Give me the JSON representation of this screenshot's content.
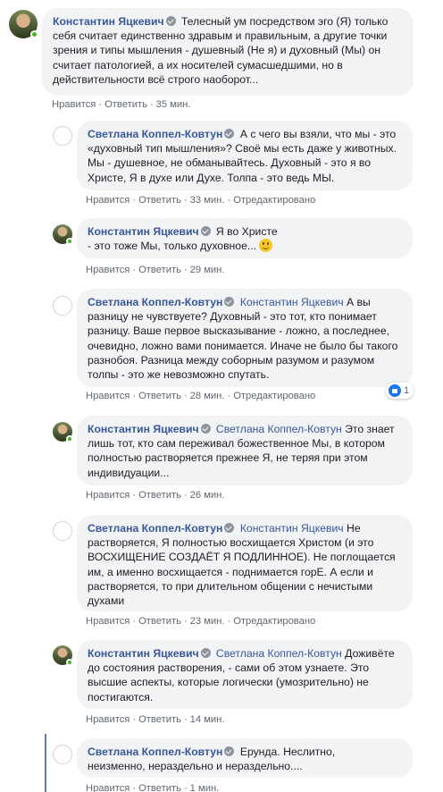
{
  "actions": {
    "like": "Нравится",
    "reply": "Ответить",
    "edited": "Отредактировано"
  },
  "colors": {
    "link": "#385898",
    "bubble": "#f2f3f5",
    "online": "#42b72a",
    "meta": "#606770"
  },
  "comments": [
    {
      "author": "Константин Яцкевич",
      "avatar": "konstantin-avatar",
      "mention": "",
      "text": "Телесный ум посредством эго (Я) только себя считает единственно здравым и правильным, а другие точки зрения и типы мышления - душевный (Не я) и духовный (Мы) он считает патологией, а их носителей сумасшедшими, но в действительности всё строго наоборот...",
      "time": "35 мин.",
      "edited": false
    },
    {
      "author": "Светлана Коппел-Ковтун",
      "avatar": "svetlana-avatar",
      "mention": "",
      "text": "А с чего вы взяли, что мы - это «духовный тип мышления»? Своё мы есть даже у животных. Мы - душевное, не обманывайтесь. Духовный - это я во Христе, Я в духе или Духе. Толпа - это ведь МЫ.",
      "time": "33 мин.",
      "edited": true
    },
    {
      "author": "Константин Яцкевич",
      "avatar": "konstantin-avatar",
      "mention": "",
      "text": "Я во Христе - это тоже Мы, только духовное...",
      "time": "29 мин.",
      "edited": false
    },
    {
      "author": "Светлана Коппел-Ковтун",
      "avatar": "svetlana-avatar",
      "mention": "Константин Яцкевич",
      "text": "А вы разницу не чувствуете? Духовный - это тот, кто понимает разницу. Ваше первое высказывание - ложно, а последнее, очевидно, ложно вами понимается. Иначе не было бы такого разнобоя. Разница между соборным разумом и разумом толпы - это же невозможно спутать.",
      "time": "28 мин.",
      "edited": true,
      "reactions": "1"
    },
    {
      "author": "Константин Яцкевич",
      "avatar": "konstantin-avatar",
      "mention": "Светлана Коппел-Ковтун",
      "text": "Это знает лишь тот, кто сам переживал божественное Мы, в котором полностью растворяется прежнее Я, не теряя при этом индивидуации...",
      "time": "26 мин.",
      "edited": false
    },
    {
      "author": "Светлана Коппел-Ковтун",
      "avatar": "svetlana-avatar",
      "mention": "Константин Яцкевич",
      "text": "Не растворяется, Я полностью восхищается Христом (и это ВОСХИЩЕНИЕ СОЗДАЁТ Я ПОДЛИННОЕ). Не поглощается им, а именно восхищается - поднимается горЕ. А если и растворяется, то при длительном общении с нечистыми духами",
      "time": "23 мин.",
      "edited": true
    },
    {
      "author": "Константин Яцкевич",
      "avatar": "konstantin-avatar",
      "mention": "Светлана Коппел-Ковтун",
      "text": "Доживёте до состояния растворения, - сами об этом узнаете. Это высшие аспекты, которые логически (умозрительно) не постигаются.",
      "time": "14 мин.",
      "edited": false
    },
    {
      "author": "Светлана Коппел-Ковтун",
      "avatar": "svetlana-avatar",
      "mention": "",
      "text": "Ерунда. Неслитно, неизменно, нераздельно и нераздельно....",
      "time": "1 мин.",
      "edited": false
    }
  ]
}
